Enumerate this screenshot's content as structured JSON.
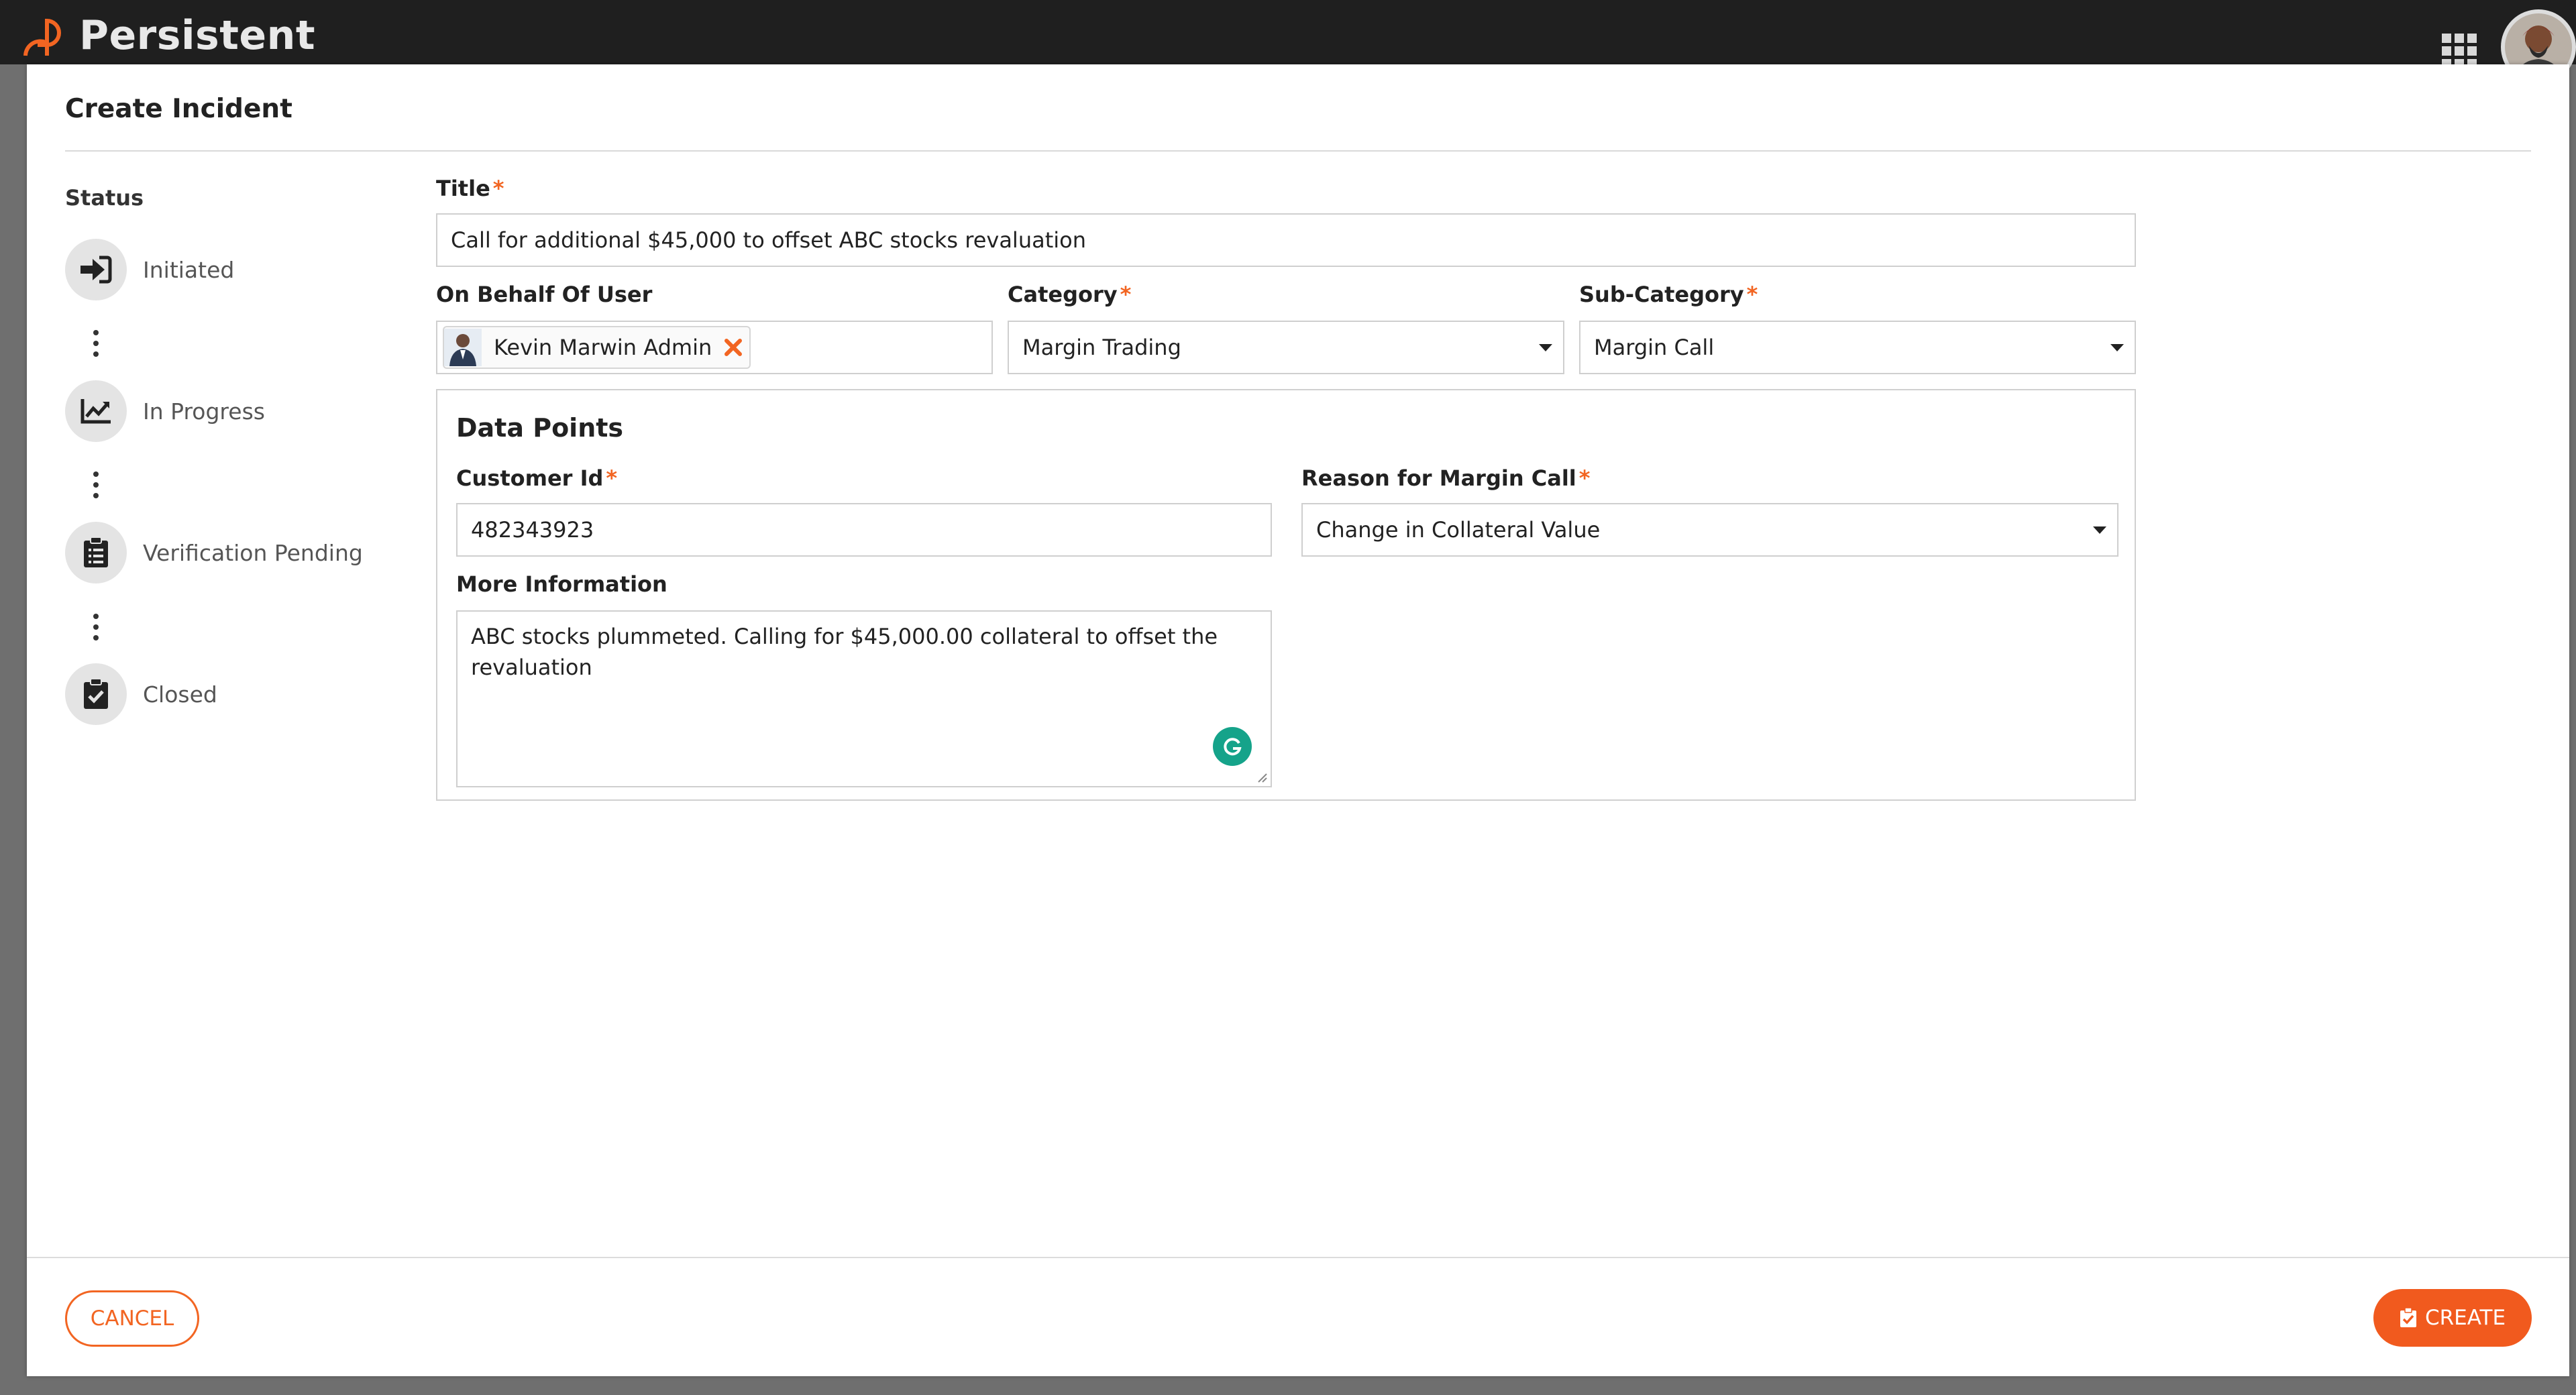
{
  "app": {
    "brand_name": "Persistent",
    "brand_color": "#f26522"
  },
  "modal": {
    "title": "Create Incident"
  },
  "status": {
    "heading": "Status",
    "steps": [
      {
        "label": "Initiated",
        "icon": "sign-in-icon"
      },
      {
        "label": "In Progress",
        "icon": "chart-line-icon"
      },
      {
        "label": "Verification Pending",
        "icon": "clipboard-list-icon"
      },
      {
        "label": "Closed",
        "icon": "clipboard-check-icon"
      }
    ]
  },
  "form": {
    "title": {
      "label": "Title",
      "required": "*",
      "value": "Call for additional $45,000 to offset ABC stocks revaluation"
    },
    "on_behalf": {
      "label": "On Behalf Of User",
      "chip": "Kevin Marwin Admin"
    },
    "category": {
      "label": "Category",
      "required": "*",
      "value": "Margin Trading"
    },
    "sub_category": {
      "label": "Sub-Category",
      "required": "*",
      "value": "Margin Call"
    },
    "data_points": {
      "title": "Data Points",
      "customer_id": {
        "label": "Customer Id",
        "required": "*",
        "value": "482343923"
      },
      "reason": {
        "label": "Reason for Margin Call",
        "required": "*",
        "value": "Change in Collateral Value"
      },
      "more_info": {
        "label": "More Information",
        "value": "ABC stocks plummeted. Calling for $45,000.00 collateral to offset the revaluation"
      }
    }
  },
  "footer": {
    "cancel_label": "CANCEL",
    "create_label": "CREATE"
  }
}
